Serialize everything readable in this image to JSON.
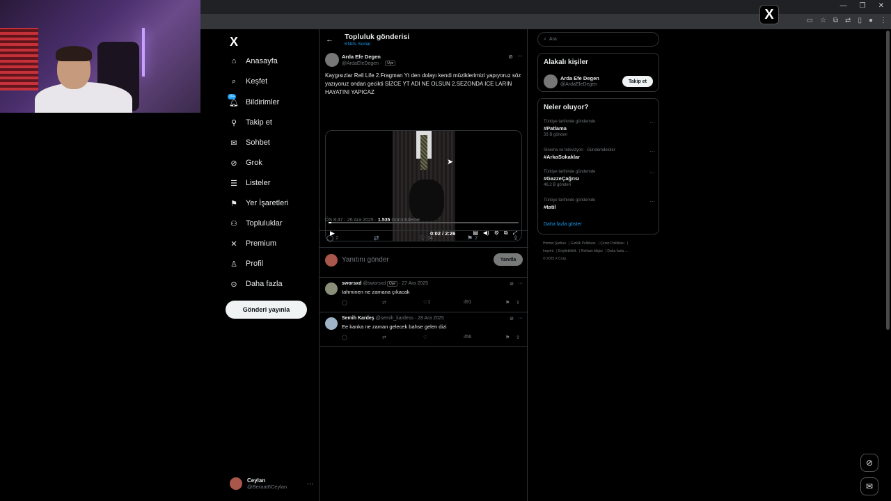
{
  "browser": {
    "window_controls": [
      "—",
      "❐",
      "✕"
    ],
    "x_app_icon": "X"
  },
  "nav": {
    "logo": "X",
    "notifications_badge": "20+",
    "items": [
      {
        "label": "Anasayfa",
        "icon": "home-icon"
      },
      {
        "label": "Keşfet",
        "icon": "search-icon"
      },
      {
        "label": "Bildirimler",
        "icon": "bell-icon"
      },
      {
        "label": "Takip et",
        "icon": "person-plus-icon"
      },
      {
        "label": "Sohbet",
        "icon": "envelope-icon"
      },
      {
        "label": "Grok",
        "icon": "grok-icon"
      },
      {
        "label": "Listeler",
        "icon": "list-icon"
      },
      {
        "label": "Yer İşaretleri",
        "icon": "bookmark-icon"
      },
      {
        "label": "Topluluklar",
        "icon": "communities-icon"
      },
      {
        "label": "Premium",
        "icon": "x-premium-icon"
      },
      {
        "label": "Profil",
        "icon": "person-icon"
      },
      {
        "label": "Daha fazla",
        "icon": "more-circle-icon"
      }
    ],
    "post_button": "Gönderi yayınla",
    "account": {
      "name": "Ceylan",
      "handle": "@Beraat6Ceylan",
      "more": "···"
    }
  },
  "main": {
    "header": {
      "title": "Topluluk gönderisi",
      "subtitle": "KNGL Social"
    },
    "post": {
      "author": "Arda Efe Degen",
      "handle": "@ArdaEfeDegen ·",
      "member_badge": "Üye",
      "text": "Kaygısızlar Rell Life 2.Fragman Yt den dolayı kendi müziklerimizi yapıyoruz söz yazıyoruz ondan gecikti SİZCE YT ADI NE OLSUN 2.SEZONDA ICE LARIN HAYATINI YAPICAZ",
      "video": {
        "time": "0:02 / 2:26",
        "progress_fraction": 0.015
      },
      "meta_time": "ÖS 8:47 · 26 Ara 2025 ·",
      "views": "1.535",
      "views_label": "Görüntüleme",
      "stats": {
        "replies": "2",
        "likes": "14",
        "bookmarks": "2"
      }
    },
    "reply_box": {
      "placeholder": "Yanıtını gönder",
      "button": "Yanıtla"
    },
    "comments": [
      {
        "name": "sworsxd",
        "handle": "@sworsxd",
        "badge": "Üye",
        "date": "· 27 Ara 2025",
        "text": "tahminen ne zamana çıkacak",
        "likes": "1",
        "views": "91"
      },
      {
        "name": "Semih Kardeş",
        "handle": "@semih_kardess",
        "badge": "",
        "date": "· 28 Ara 2025",
        "text": "Ee kanka ne zaman gelecek bahse gelen dizi",
        "likes": "",
        "views": "56"
      }
    ]
  },
  "right": {
    "search_placeholder": "Ara",
    "related": {
      "title": "Alakalı kişiler",
      "name": "Arda Efe Degen",
      "handle": "@ArdaEfeDegen",
      "follow": "Takip et"
    },
    "trends": {
      "title": "Neler oluyor?",
      "items": [
        {
          "context": "Türkiye tarihinde gündemde",
          "tag": "#Patlama",
          "count": "33 B gönderi"
        },
        {
          "context": "Sinema ve televizyon · Gündemdekiler",
          "tag": "#ArkaSokaklar",
          "count": ""
        },
        {
          "context": "Türkiye tarihinde gündemde",
          "tag": "#GazzeÇağrısı",
          "count": "46,2 B gönderi"
        },
        {
          "context": "Türkiye tarihinde gündemde",
          "tag": "#tatil",
          "count": ""
        }
      ],
      "show_more": "Daha fazla göster"
    },
    "footer": [
      "Hizmet Şartları",
      "Gizlilik Politikası",
      "Çerez Politikası",
      "Imprint",
      "Erişilebilirlik",
      "Reklam bilgisi",
      "Daha fazla ...",
      "© 2025 X Corp."
    ]
  }
}
